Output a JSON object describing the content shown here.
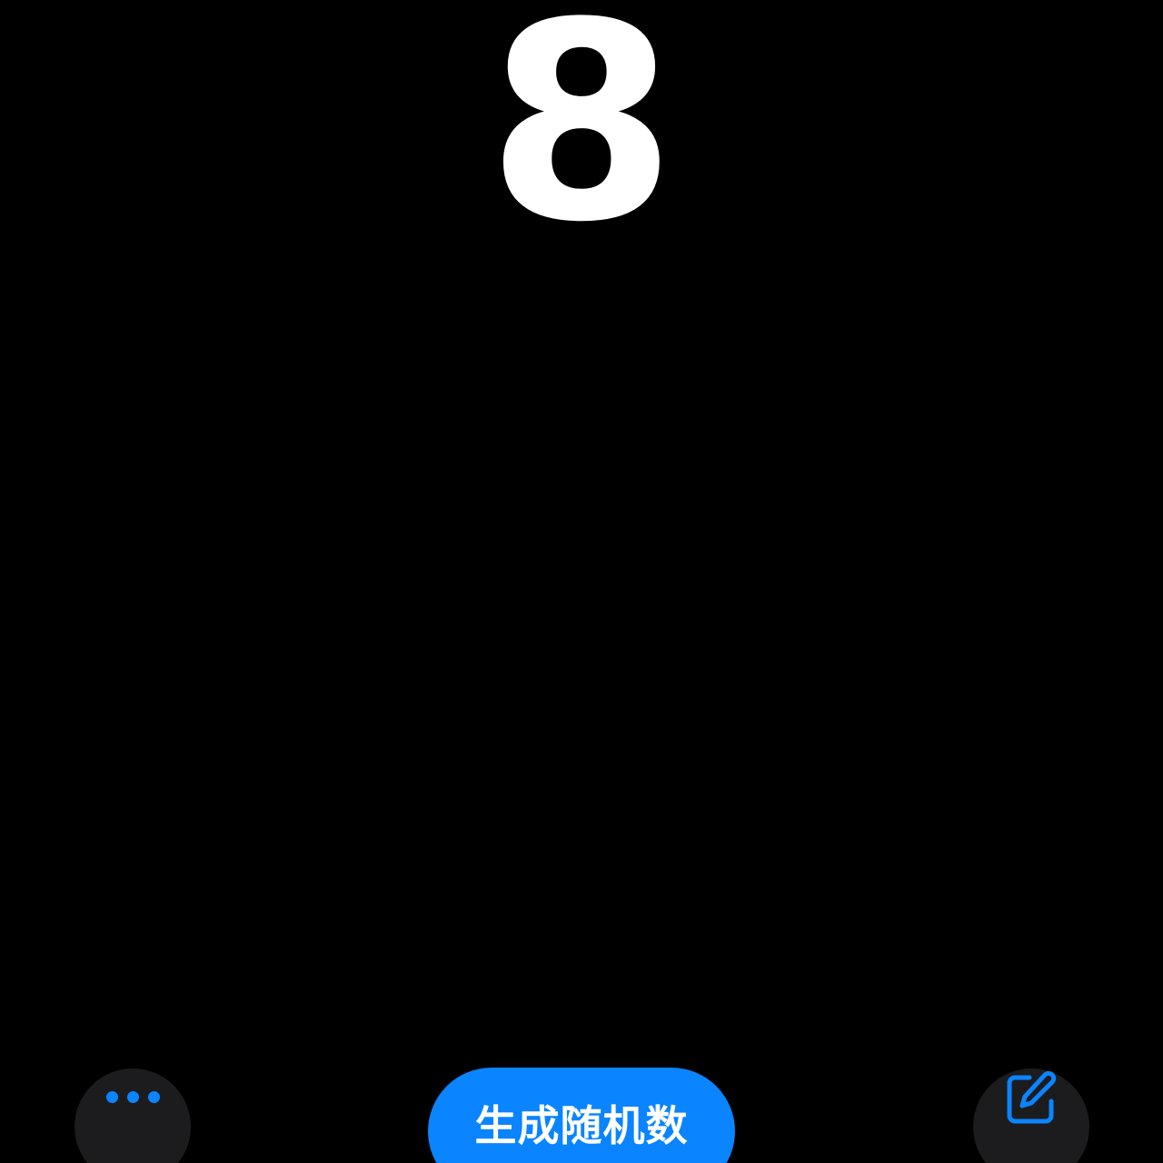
{
  "result": {
    "value": "8"
  },
  "toolbar": {
    "more_icon": "ellipsis-icon",
    "generate_label": "生成随机数",
    "edit_icon": "square-pencil-icon"
  },
  "colors": {
    "background": "#000000",
    "accent": "#0a84ff",
    "button_dark": "#1c1c1e",
    "text": "#ffffff"
  }
}
